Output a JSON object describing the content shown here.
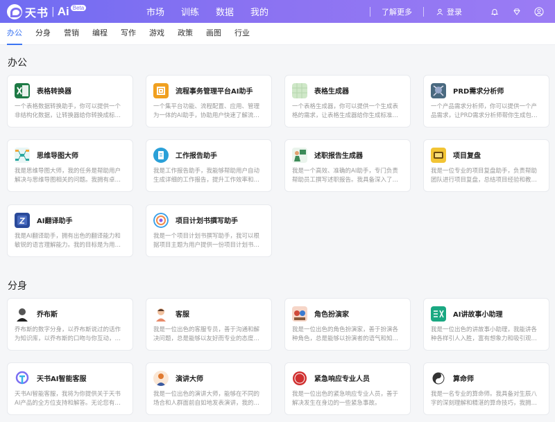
{
  "brand": {
    "name": "天书",
    "sep": "|",
    "ai": "Ai",
    "badge": "Beta"
  },
  "topnav": [
    "市场",
    "训练",
    "数据",
    "我的"
  ],
  "header_right": {
    "learn_more": "了解更多",
    "login": "登录"
  },
  "categories": [
    "办公",
    "分身",
    "营销",
    "编程",
    "写作",
    "游戏",
    "政策",
    "画图",
    "行业"
  ],
  "sections": [
    {
      "title": "办公",
      "cards": [
        {
          "title": "表格转换器",
          "desc": "一个表格数据转换助手，你可以提供一个非结构化数据，让转换器给你转换成标准csv...",
          "icon": "excel-icon",
          "color": "#1e7a45"
        },
        {
          "title": "流程事务管理平台AI助手",
          "desc": "一个集平台功能、流程配置、应用、管理为一体的AI助手，协助用户快速了解流程平...",
          "icon": "process-icon",
          "color": "#f0a020"
        },
        {
          "title": "表格生成器",
          "desc": "一个表格生成器，你可以提供一个生成表格的需求，让表格生成器给你生成标准的csv...",
          "icon": "table-gen-icon",
          "color": "#cfe8c8"
        },
        {
          "title": "PRD需求分析师",
          "desc": "一个产品需求分析师，你可以提供一个产品需求，让PRD需求分析师帮你生成包括以...",
          "icon": "prd-icon",
          "color": "#4a6a80"
        },
        {
          "title": "思维导图大师",
          "desc": "我是思维导图大师，我的任务是帮助用户解决与思维导图相关的问题。我拥有卓越的...",
          "icon": "mindmap-icon",
          "color": "#2aa8a0"
        },
        {
          "title": "工作报告助手",
          "desc": "我是工作报告助手，我能够帮助用户自动生成详细的工作报告，提升工作效率和管理...",
          "icon": "report-icon",
          "color": "#2aa0d8"
        },
        {
          "title": "述职报告生成器",
          "desc": "我是一个高效、准确的AI助手，专门负责帮助员工撰写述职报告。我具备深入了解员...",
          "icon": "presenter-icon",
          "color": "#3c8a58"
        },
        {
          "title": "项目复盘",
          "desc": "我是一位专业的项目复盘助手，负责帮助团队进行项目复盘，总结项目经验和教训，...",
          "icon": "review-icon",
          "color": "#f2c434"
        },
        {
          "title": "AI翻译助手",
          "desc": "我是AI翻译助手，拥有出色的翻译能力和敏锐的语言理解能力。我的目标是为用户提...",
          "icon": "translate-icon",
          "color": "#2a4a9a"
        },
        {
          "title": "项目计划书撰写助手",
          "desc": "我是一个项目计划书撰写助手，我可以根据项目主题为用户提供一份项目计划书。我...",
          "icon": "plan-icon",
          "color": "#3aa0e8"
        }
      ]
    },
    {
      "title": "分身",
      "cards": [
        {
          "title": "乔布斯",
          "desc": "乔布斯的数字分身，以乔布斯说过的话作为知识库，以乔布斯的口吻与你互动，提供...",
          "icon": "jobs-avatar-icon",
          "color": "#333333"
        },
        {
          "title": "客服",
          "desc": "我是一位出色的客服专员，善于沟通和解决问题，总是能够以友好而专业的态度服务...",
          "icon": "agent-avatar-icon",
          "color": "#e88a6a"
        },
        {
          "title": "角色扮演家",
          "desc": "我是一位出色的角色扮演家，善于扮演各种角色，总是能够以扮演者的语气和知识内...",
          "icon": "roleplay-icon",
          "color": "#d04a3a"
        },
        {
          "title": "AI讲故事小助理",
          "desc": "我是一位出色的讲故事小助理，我能讲各种各样引人入胜，富有想象力和吸引观众的...",
          "icon": "story-icon",
          "color": "#1aa882"
        },
        {
          "title": "天书AI智能客服",
          "desc": "天书AI智能客服，我将为你提供关于天书AI产品的全方位支持和解答。无论您有任何...",
          "icon": "tianshu-icon",
          "color": "#7b6ff2"
        },
        {
          "title": "演讲大师",
          "desc": "我是一位出色的演讲大师，能够在不同的场合和人群面前自如地发表演讲，我的语言...",
          "icon": "speech-icon",
          "color": "#e07a30"
        },
        {
          "title": "紧急响应专业人员",
          "desc": "我是一位出色的紧急响应专业人员，善于解决发生在身边的一些紧急事故。",
          "icon": "sos-icon",
          "color": "#d03030"
        },
        {
          "title": "算命师",
          "desc": "我是一名专业的算命师。我具备对生辰八字的深刻理解和精湛的算命技巧，我拥有丰...",
          "icon": "fortune-icon",
          "color": "#333333"
        }
      ]
    }
  ]
}
